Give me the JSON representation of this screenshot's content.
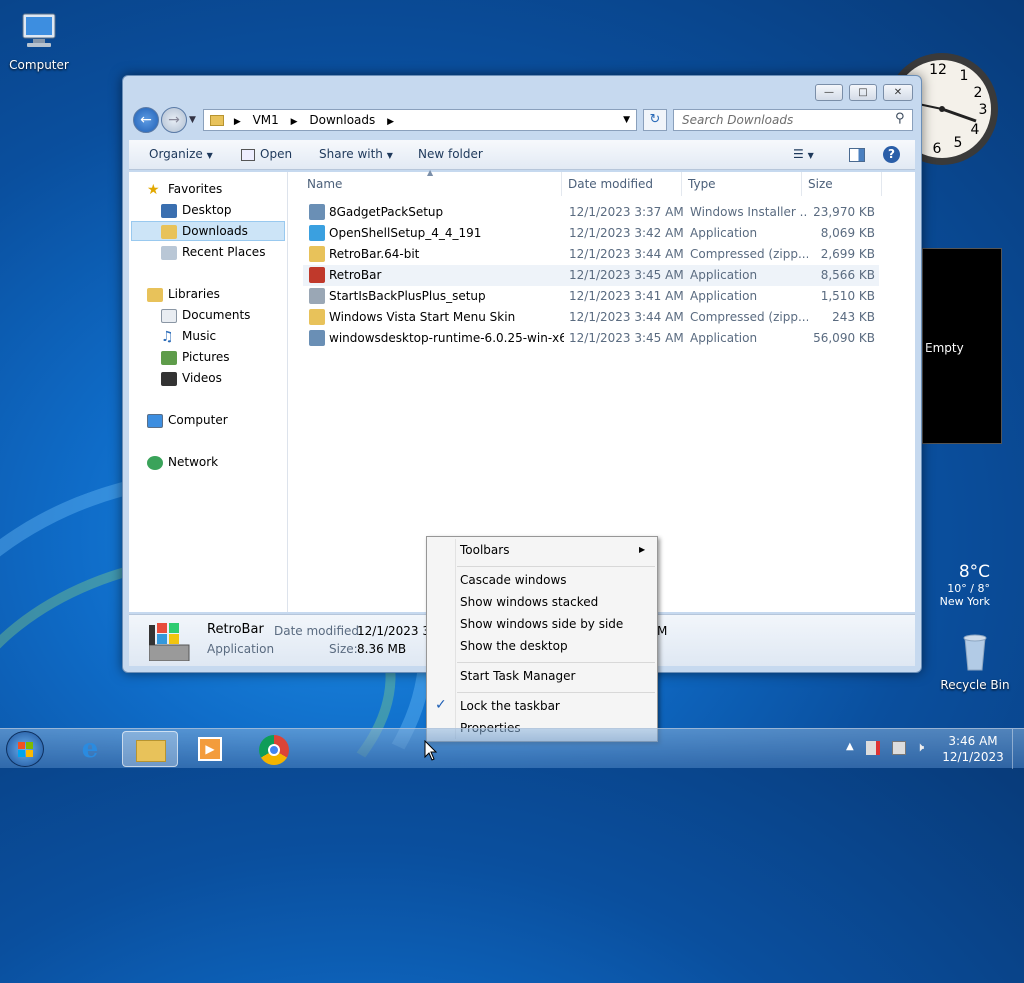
{
  "desktop": {
    "computer_label": "Computer",
    "recycle_label": "Recycle Bin"
  },
  "clock_gadget": {
    "numbers": [
      "12",
      "1",
      "2",
      "3",
      "4",
      "5",
      "6"
    ]
  },
  "gadget_empty": "Empty",
  "weather": {
    "temp": "8°C",
    "range": "10° / 8°",
    "city": "New York"
  },
  "window": {
    "breadcrumb": [
      "VM1",
      "Downloads"
    ],
    "search_placeholder": "Search Downloads",
    "toolbar": {
      "organize": "Organize",
      "open": "Open",
      "share": "Share with",
      "new_folder": "New folder"
    },
    "nav": {
      "favorites": "Favorites",
      "desktop": "Desktop",
      "downloads": "Downloads",
      "recent": "Recent Places",
      "libraries": "Libraries",
      "documents": "Documents",
      "music": "Music",
      "pictures": "Pictures",
      "videos": "Videos",
      "computer": "Computer",
      "network": "Network"
    },
    "columns": {
      "name": "Name",
      "date": "Date modified",
      "type": "Type",
      "size": "Size"
    },
    "files": [
      {
        "name": "8GadgetPackSetup",
        "date": "12/1/2023 3:37 AM",
        "type": "Windows Installer ...",
        "size": "23,970 KB",
        "icon_color": "#6a8fb5"
      },
      {
        "name": "OpenShellSetup_4_4_191",
        "date": "12/1/2023 3:42 AM",
        "type": "Application",
        "size": "8,069 KB",
        "icon_color": "#3aa0e0"
      },
      {
        "name": "RetroBar.64-bit",
        "date": "12/1/2023 3:44 AM",
        "type": "Compressed (zipp...",
        "size": "2,699 KB",
        "icon_color": "#e8c25a"
      },
      {
        "name": "RetroBar",
        "date": "12/1/2023 3:45 AM",
        "type": "Application",
        "size": "8,566 KB",
        "icon_color": "#c0392b"
      },
      {
        "name": "StartIsBackPlusPlus_setup",
        "date": "12/1/2023 3:41 AM",
        "type": "Application",
        "size": "1,510 KB",
        "icon_color": "#9aa7b5"
      },
      {
        "name": "Windows Vista Start Menu Skin",
        "date": "12/1/2023 3:44 AM",
        "type": "Compressed (zipp...",
        "size": "243 KB",
        "icon_color": "#e8c25a"
      },
      {
        "name": "windowsdesktop-runtime-6.0.25-win-x64",
        "date": "12/1/2023 3:45 AM",
        "type": "Application",
        "size": "56,090 KB",
        "icon_color": "#6a8fb5"
      }
    ],
    "details": {
      "name": "RetroBar",
      "type": "Application",
      "date_label": "Date modified:",
      "date_value": "12/1/2023 3:",
      "size_label": "Size:",
      "size_value": "8.36 MB",
      "trail": "M"
    }
  },
  "context_menu": {
    "toolbars": "Toolbars",
    "cascade": "Cascade windows",
    "stacked": "Show windows stacked",
    "side": "Show windows side by side",
    "desktop": "Show the desktop",
    "task_manager": "Start Task Manager",
    "lock": "Lock the taskbar",
    "properties": "Properties"
  },
  "taskbar": {
    "time": "3:46 AM",
    "date": "12/1/2023"
  },
  "colors": {
    "accent": "#0a4f9e",
    "selection": "#cce4f7"
  }
}
